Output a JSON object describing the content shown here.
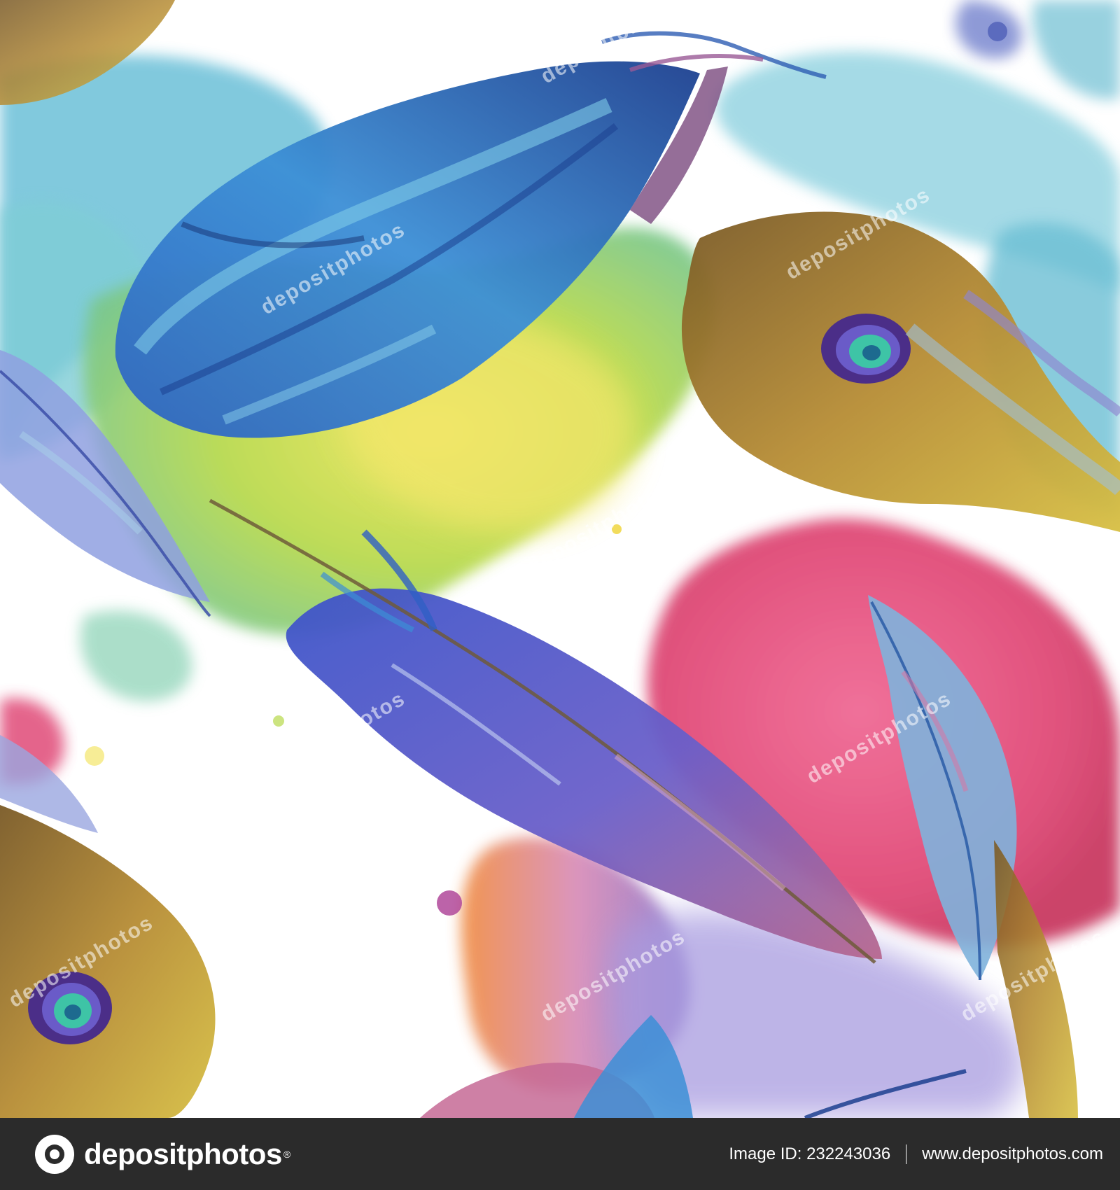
{
  "artwork": {
    "subject": "watercolor-feathers-seamless-pattern",
    "palette": {
      "blue": "#2f6fc4",
      "navy": "#1c3f8f",
      "teal": "#5fc0cf",
      "sky": "#9fd6e6",
      "lime": "#b7d94a",
      "yellow": "#f1e25a",
      "pink": "#e04a77",
      "orange": "#f08a3e",
      "violet": "#8a72c6",
      "brown": "#8c6a2a",
      "ochre": "#c9a33b"
    },
    "watermark": "depositphotos"
  },
  "footer": {
    "logo_text": "depositphotos",
    "image_id_text": "Image ID: 232243036",
    "url_text": "www.depositphotos.com"
  }
}
